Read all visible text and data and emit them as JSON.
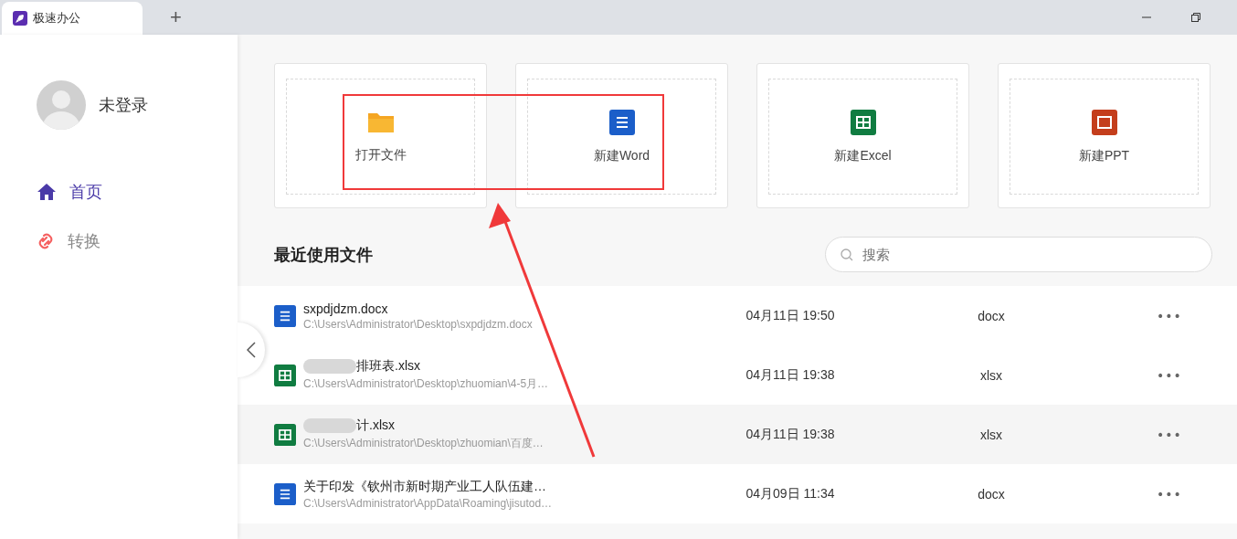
{
  "window": {
    "tab_title": "极速办公",
    "new_tab": "+"
  },
  "sidebar": {
    "user": "未登录",
    "items": [
      {
        "label": "首页",
        "kind": "home",
        "selected": true
      },
      {
        "label": "转换",
        "kind": "convert",
        "selected": false
      }
    ]
  },
  "actions": [
    {
      "label": "打开文件",
      "kind": "folder"
    },
    {
      "label": "新建Word",
      "kind": "word"
    },
    {
      "label": "新建Excel",
      "kind": "excel"
    },
    {
      "label": "新建PPT",
      "kind": "ppt"
    }
  ],
  "recent": {
    "title": "最近使用文件",
    "search": {
      "placeholder": "搜索"
    },
    "rows": [
      {
        "name": "sxpdjdzm.docx",
        "blurred": false,
        "path": "C:\\Users\\Administrator\\Desktop\\sxpdjdzm.docx",
        "time": "04月11日 19:50",
        "type": "docx",
        "kind": "word",
        "highlighted": false,
        "more": "•••"
      },
      {
        "name": "排班表.xlsx",
        "blurred": true,
        "path": "C:\\Users\\Administrator\\Desktop\\zhuomian\\4-5月…",
        "time": "04月11日 19:38",
        "type": "xlsx",
        "kind": "excel",
        "highlighted": false,
        "more": "•••"
      },
      {
        "name": "计.xlsx",
        "blurred": true,
        "path": "C:\\Users\\Administrator\\Desktop\\zhuomian\\百度…",
        "time": "04月11日 19:38",
        "type": "xlsx",
        "kind": "excel",
        "highlighted": true,
        "more": "•••"
      },
      {
        "name": "关于印发《钦州市新时期产业工人队伍建…",
        "blurred": false,
        "path": "C:\\Users\\Administrator\\AppData\\Roaming\\jisutod…",
        "time": "04月09日 11:34",
        "type": "docx",
        "kind": "word",
        "highlighted": false,
        "more": "•••"
      }
    ]
  }
}
